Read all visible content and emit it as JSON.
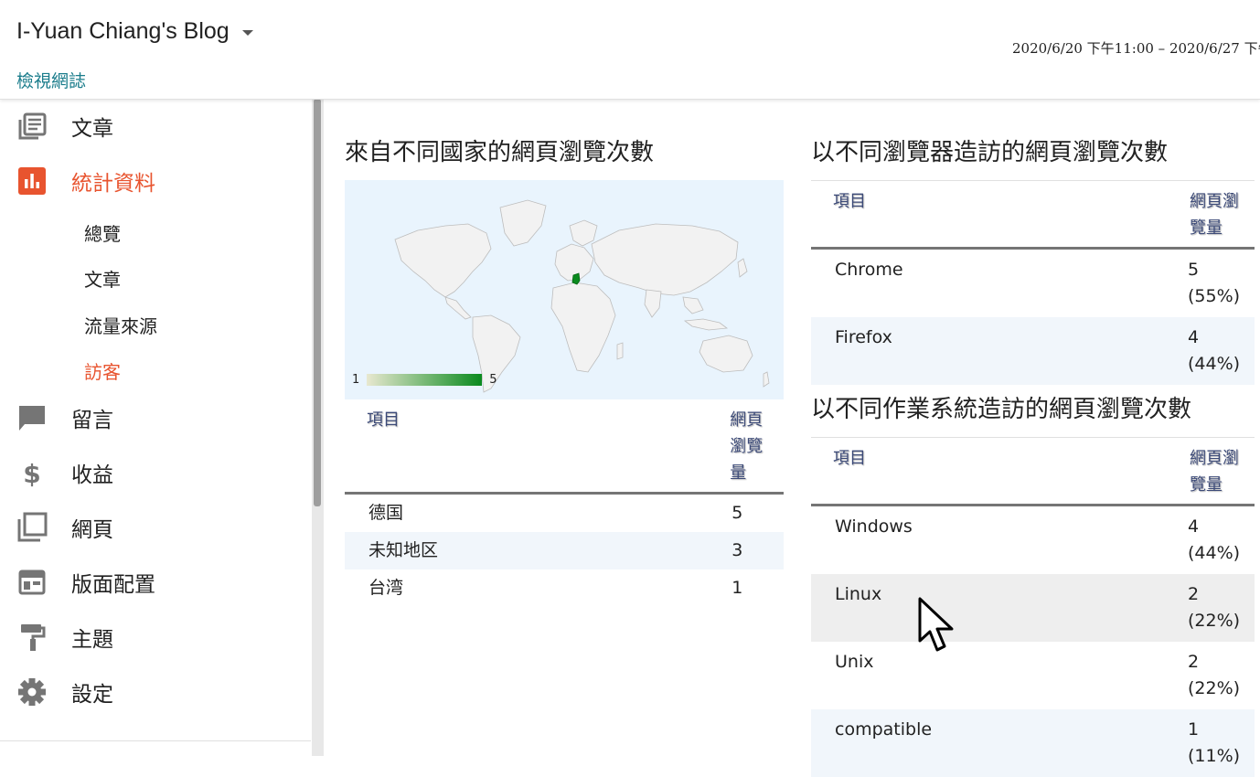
{
  "header": {
    "blog_title": "I-Yuan Chiang's Blog",
    "view_blog": "檢視網誌",
    "date_range": "2020/6/20 下午11:00 – 2020/6/27 下午"
  },
  "sidebar": {
    "items": [
      {
        "label": "文章",
        "icon": "posts-icon"
      },
      {
        "label": "統計資料",
        "icon": "stats-icon",
        "active": true
      },
      {
        "label": "留言",
        "icon": "comment-icon"
      },
      {
        "label": "收益",
        "icon": "dollar-icon"
      },
      {
        "label": "網頁",
        "icon": "pages-icon"
      },
      {
        "label": "版面配置",
        "icon": "layout-icon"
      },
      {
        "label": "主題",
        "icon": "paint-roller-icon"
      },
      {
        "label": "設定",
        "icon": "gear-icon"
      }
    ],
    "sub_items": [
      {
        "label": "總覽"
      },
      {
        "label": "文章"
      },
      {
        "label": "流量來源"
      },
      {
        "label": "訪客",
        "active": true
      }
    ]
  },
  "countries": {
    "title": "來自不同國家的網頁瀏覽次數",
    "legend_min": "1",
    "legend_max": "5",
    "col_item": "項目",
    "col_views": "網頁瀏覽量",
    "rows": [
      {
        "item": "德国",
        "views": "5"
      },
      {
        "item": "未知地区",
        "views": "3"
      },
      {
        "item": "台湾",
        "views": "1"
      }
    ]
  },
  "browsers": {
    "title": "以不同瀏覽器造訪的網頁瀏覽次數",
    "col_item": "項目",
    "col_views": "網頁瀏覽量",
    "rows": [
      {
        "item": "Chrome",
        "views": "5",
        "pct": "(55%)"
      },
      {
        "item": "Firefox",
        "views": "4",
        "pct": "(44%)"
      }
    ]
  },
  "os": {
    "title": "以不同作業系統造訪的網頁瀏覽次數",
    "col_item": "項目",
    "col_views": "網頁瀏覽量",
    "rows": [
      {
        "item": "Windows",
        "views": "4",
        "pct": "(44%)"
      },
      {
        "item": "Linux",
        "views": "2",
        "pct": "(22%)"
      },
      {
        "item": "Unix",
        "views": "2",
        "pct": "(22%)"
      },
      {
        "item": "compatible",
        "views": "1",
        "pct": "(11%)"
      }
    ]
  },
  "colors": {
    "accent": "#e8542f",
    "link": "#1a7c8b",
    "map_highlight": "#0a8a1e"
  }
}
